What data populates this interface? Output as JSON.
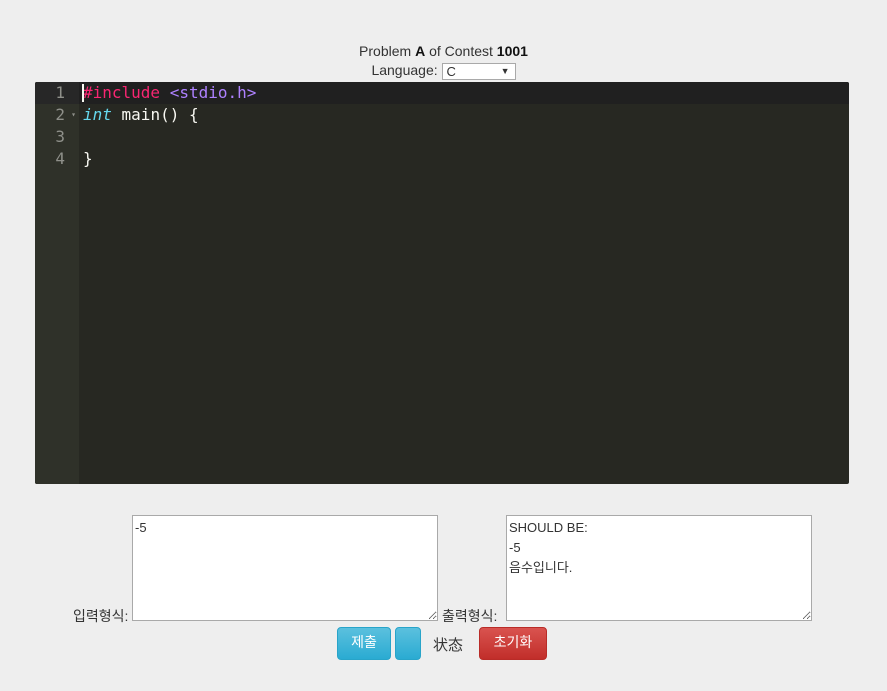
{
  "header": {
    "problem_prefix": "Problem",
    "problem_id": "A",
    "of_contest": "of Contest",
    "contest_id": "1001",
    "language_label": "Language:",
    "language_selected": "C"
  },
  "editor": {
    "line_numbers": [
      "1",
      "2",
      "3",
      "4"
    ],
    "lines": {
      "l1_directive": "#include",
      "l1_header": "<stdio.h>",
      "l2_type": "int",
      "l2_rest": " main() {",
      "l3": "",
      "l4": "}"
    }
  },
  "io": {
    "input_label": "입력형식:",
    "input_value": "-5",
    "output_label": "출력형식:",
    "output_value": "SHOULD BE:\n-5\n음수입니다."
  },
  "actions": {
    "submit_label": "제출",
    "blank_label": "",
    "status_label": "状态",
    "reset_label": "초기화"
  }
}
